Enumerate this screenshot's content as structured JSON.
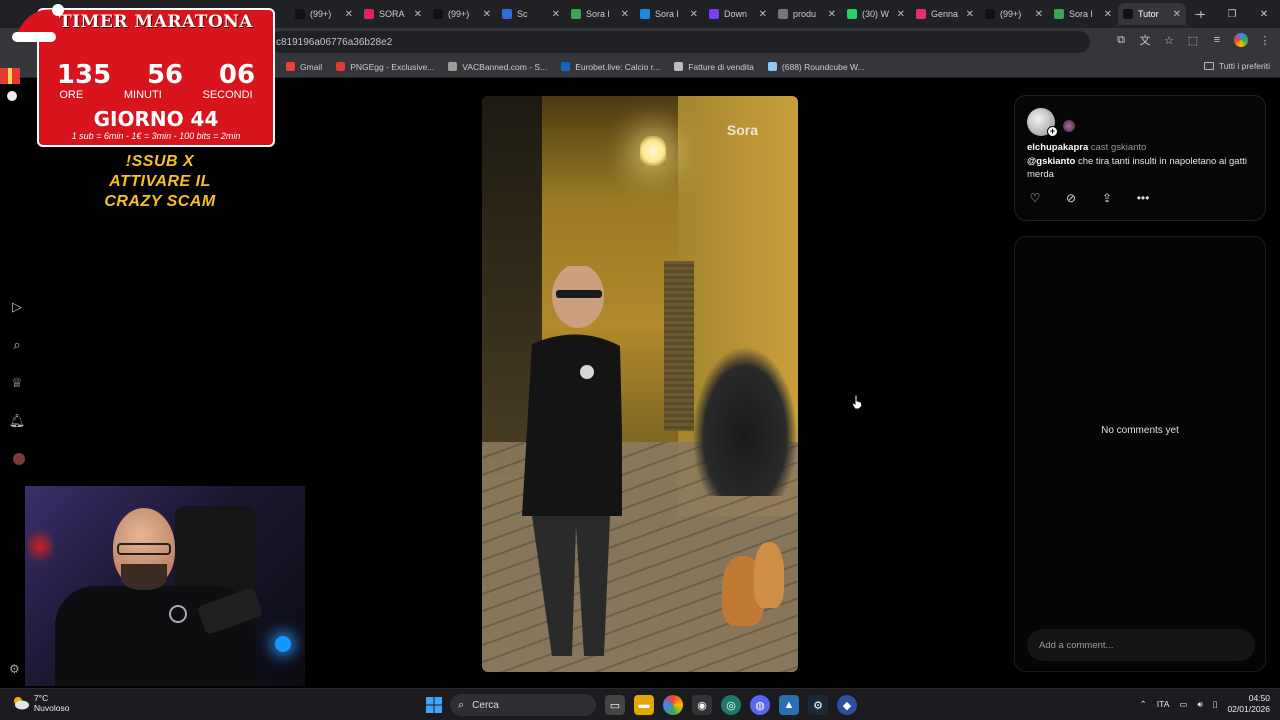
{
  "browser": {
    "tabs": [
      {
        "label": "(99+)",
        "color": "#111111",
        "icon": "tiktok-icon",
        "active": false
      },
      {
        "label": "SORA",
        "color": "#e0245e",
        "icon": "sora-icon",
        "active": false
      },
      {
        "label": "(99+)",
        "color": "#111111",
        "icon": "tiktok-icon",
        "active": false
      },
      {
        "label": "Sc",
        "color": "#2f6fdb",
        "icon": "signal-icon",
        "active": false
      },
      {
        "label": "Sora l",
        "color": "#3aa655",
        "icon": "play-icon",
        "active": false
      },
      {
        "label": "Sora l",
        "color": "#1e88e5",
        "icon": "app-icon",
        "active": false
      },
      {
        "label": "Down",
        "color": "#7b3ff2",
        "icon": "c-icon",
        "active": false
      },
      {
        "label": "produ",
        "color": "#777777",
        "icon": "globe-icon",
        "active": false
      },
      {
        "label": "(30) W",
        "color": "#25d366",
        "icon": "whatsapp-icon",
        "active": false
      },
      {
        "label": "Genna",
        "color": "#e1306c",
        "icon": "instagram-icon",
        "active": false
      },
      {
        "label": "(99+)",
        "color": "#111111",
        "icon": "tiktok-icon",
        "active": false
      },
      {
        "label": "Sora l",
        "color": "#3aa655",
        "icon": "play-icon",
        "active": false
      },
      {
        "label": "Tutor",
        "color": "#111111",
        "icon": "tiktok-icon",
        "active": true
      }
    ],
    "address": "c819196a06776a36b28e2",
    "bookmarks": [
      {
        "label": "Gmail",
        "color": "#ea4335"
      },
      {
        "label": "PNGEgg - Exclusive...",
        "color": "#e53935"
      },
      {
        "label": "VACBanned.com - S...",
        "color": "#9e9e9e"
      },
      {
        "label": "Eurobet.live: Calcio r...",
        "color": "#1565c0"
      },
      {
        "label": "Fatture di vendita",
        "color": "#bbbbbb"
      },
      {
        "label": "(688) Roundcube W...",
        "color": "#90caf9"
      }
    ],
    "all_bookmarks": "Tutti i preferiti"
  },
  "overlay": {
    "title": "TIMER MARATONA",
    "hours": "135",
    "minutes": "56",
    "seconds": "06",
    "hours_label": "ORE",
    "minutes_label": "MINUTI",
    "seconds_label": "SECONDI",
    "day": "GIORNO 44",
    "rule": "1 sub = 6min - 1€ = 3min - 100 bits = 2min",
    "promo_line1": "!SSUB X",
    "promo_line2": "ATTIVARE IL",
    "promo_line3": "CRAZY SCAM"
  },
  "video": {
    "watermark": "Sora"
  },
  "post": {
    "author": "elchupakapra",
    "cast_label": "cast gskianto",
    "mention": "@gskianto",
    "caption": "che tira tanti insulti in napoletano ai gatti merda"
  },
  "comments": {
    "empty_text": "No comments yet",
    "placeholder": "Add a comment..."
  },
  "taskbar": {
    "temperature": "7°C",
    "weather": "Nuvoloso",
    "search_placeholder": "Cerca",
    "language": "ITA",
    "time": "04:50",
    "date": "02/01/2026"
  }
}
